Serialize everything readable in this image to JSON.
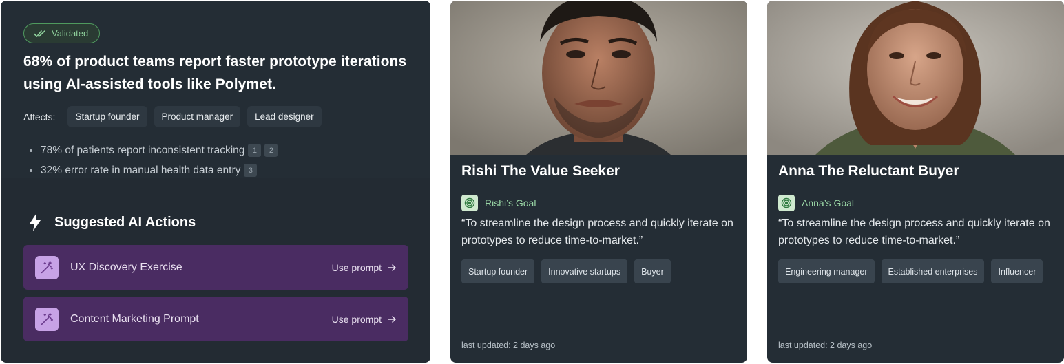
{
  "insight": {
    "badge": "Validated",
    "headline": "68% of product teams report faster prototype iterations using AI-assisted tools like Polymet.",
    "affects_label": "Affects:",
    "affects": [
      "Startup founder",
      "Product manager",
      "Lead designer"
    ],
    "bullets": [
      {
        "text": "78% of patients report inconsistent tracking",
        "refs": [
          "1",
          "2"
        ]
      },
      {
        "text": "32% error rate in manual health data entry",
        "refs": [
          "3"
        ]
      }
    ]
  },
  "actions": {
    "title": "Suggested AI Actions",
    "items": [
      {
        "label": "UX Discovery Exercise",
        "cta": "Use prompt"
      },
      {
        "label": "Content Marketing Prompt",
        "cta": "Use prompt"
      }
    ]
  },
  "personas": [
    {
      "name": "Rishi The Value Seeker",
      "goal_label": "Rishi’s Goal",
      "quote": "“To streamline the design process and quickly iterate on prototypes to reduce time-to-market.”",
      "tags": [
        "Startup founder",
        "Innovative startups",
        "Buyer"
      ],
      "updated": "last updated: 2 days ago"
    },
    {
      "name": "Anna The Reluctant Buyer",
      "goal_label": "Anna’s Goal",
      "quote": "“To streamline the design process and quickly iterate on prototypes to reduce time-to-market.”",
      "tags": [
        "Engineering manager",
        "Established enterprises",
        "Influencer"
      ],
      "updated": "last updated: 2 days ago"
    }
  ],
  "colors": {
    "card_bg": "#242d35",
    "validated_green": "#8fd19c",
    "action_purple": "#4a2c62",
    "goal_green": "#9ad7a6"
  },
  "icons": {
    "badge": "double-check-icon",
    "section": "lightning-icon",
    "action": "magic-wand-icon",
    "cta": "arrow-right-icon",
    "goal": "target-icon"
  }
}
